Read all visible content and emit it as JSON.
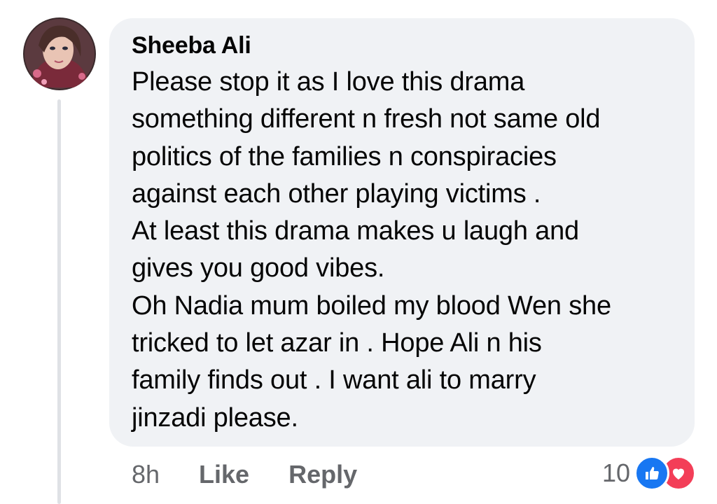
{
  "comment": {
    "author": "Sheeba Ali",
    "text": "Please stop it as I love this drama\nsomething different n fresh not same old\npolitics of the families n conspiracies\nagainst each other playing victims .\nAt least this drama makes u laugh and\ngives you good vibes.\nOh Nadia mum boiled my blood Wen she\ntricked to let azar in . Hope Ali n his\nfamily finds out . I want ali to marry\njinzadi please.",
    "time": "8h",
    "like_label": "Like",
    "reply_label": "Reply",
    "reaction_count": "10",
    "reaction_icons": [
      "like-icon",
      "love-icon"
    ]
  },
  "colors": {
    "bubble": "#f0f2f5",
    "secondary_text": "#65676b",
    "like_blue": "#1877f2",
    "love_red": "#f33e58"
  }
}
